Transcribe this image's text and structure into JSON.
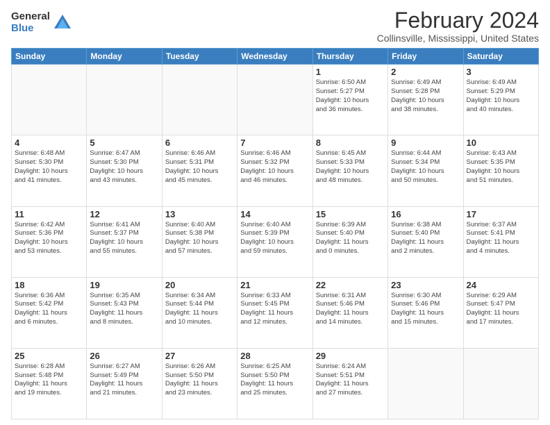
{
  "logo": {
    "general": "General",
    "blue": "Blue"
  },
  "header": {
    "title": "February 2024",
    "subtitle": "Collinsville, Mississippi, United States"
  },
  "weekdays": [
    "Sunday",
    "Monday",
    "Tuesday",
    "Wednesday",
    "Thursday",
    "Friday",
    "Saturday"
  ],
  "weeks": [
    [
      {
        "day": "",
        "info": ""
      },
      {
        "day": "",
        "info": ""
      },
      {
        "day": "",
        "info": ""
      },
      {
        "day": "",
        "info": ""
      },
      {
        "day": "1",
        "info": "Sunrise: 6:50 AM\nSunset: 5:27 PM\nDaylight: 10 hours\nand 36 minutes."
      },
      {
        "day": "2",
        "info": "Sunrise: 6:49 AM\nSunset: 5:28 PM\nDaylight: 10 hours\nand 38 minutes."
      },
      {
        "day": "3",
        "info": "Sunrise: 6:49 AM\nSunset: 5:29 PM\nDaylight: 10 hours\nand 40 minutes."
      }
    ],
    [
      {
        "day": "4",
        "info": "Sunrise: 6:48 AM\nSunset: 5:30 PM\nDaylight: 10 hours\nand 41 minutes."
      },
      {
        "day": "5",
        "info": "Sunrise: 6:47 AM\nSunset: 5:30 PM\nDaylight: 10 hours\nand 43 minutes."
      },
      {
        "day": "6",
        "info": "Sunrise: 6:46 AM\nSunset: 5:31 PM\nDaylight: 10 hours\nand 45 minutes."
      },
      {
        "day": "7",
        "info": "Sunrise: 6:46 AM\nSunset: 5:32 PM\nDaylight: 10 hours\nand 46 minutes."
      },
      {
        "day": "8",
        "info": "Sunrise: 6:45 AM\nSunset: 5:33 PM\nDaylight: 10 hours\nand 48 minutes."
      },
      {
        "day": "9",
        "info": "Sunrise: 6:44 AM\nSunset: 5:34 PM\nDaylight: 10 hours\nand 50 minutes."
      },
      {
        "day": "10",
        "info": "Sunrise: 6:43 AM\nSunset: 5:35 PM\nDaylight: 10 hours\nand 51 minutes."
      }
    ],
    [
      {
        "day": "11",
        "info": "Sunrise: 6:42 AM\nSunset: 5:36 PM\nDaylight: 10 hours\nand 53 minutes."
      },
      {
        "day": "12",
        "info": "Sunrise: 6:41 AM\nSunset: 5:37 PM\nDaylight: 10 hours\nand 55 minutes."
      },
      {
        "day": "13",
        "info": "Sunrise: 6:40 AM\nSunset: 5:38 PM\nDaylight: 10 hours\nand 57 minutes."
      },
      {
        "day": "14",
        "info": "Sunrise: 6:40 AM\nSunset: 5:39 PM\nDaylight: 10 hours\nand 59 minutes."
      },
      {
        "day": "15",
        "info": "Sunrise: 6:39 AM\nSunset: 5:40 PM\nDaylight: 11 hours\nand 0 minutes."
      },
      {
        "day": "16",
        "info": "Sunrise: 6:38 AM\nSunset: 5:40 PM\nDaylight: 11 hours\nand 2 minutes."
      },
      {
        "day": "17",
        "info": "Sunrise: 6:37 AM\nSunset: 5:41 PM\nDaylight: 11 hours\nand 4 minutes."
      }
    ],
    [
      {
        "day": "18",
        "info": "Sunrise: 6:36 AM\nSunset: 5:42 PM\nDaylight: 11 hours\nand 6 minutes."
      },
      {
        "day": "19",
        "info": "Sunrise: 6:35 AM\nSunset: 5:43 PM\nDaylight: 11 hours\nand 8 minutes."
      },
      {
        "day": "20",
        "info": "Sunrise: 6:34 AM\nSunset: 5:44 PM\nDaylight: 11 hours\nand 10 minutes."
      },
      {
        "day": "21",
        "info": "Sunrise: 6:33 AM\nSunset: 5:45 PM\nDaylight: 11 hours\nand 12 minutes."
      },
      {
        "day": "22",
        "info": "Sunrise: 6:31 AM\nSunset: 5:46 PM\nDaylight: 11 hours\nand 14 minutes."
      },
      {
        "day": "23",
        "info": "Sunrise: 6:30 AM\nSunset: 5:46 PM\nDaylight: 11 hours\nand 15 minutes."
      },
      {
        "day": "24",
        "info": "Sunrise: 6:29 AM\nSunset: 5:47 PM\nDaylight: 11 hours\nand 17 minutes."
      }
    ],
    [
      {
        "day": "25",
        "info": "Sunrise: 6:28 AM\nSunset: 5:48 PM\nDaylight: 11 hours\nand 19 minutes."
      },
      {
        "day": "26",
        "info": "Sunrise: 6:27 AM\nSunset: 5:49 PM\nDaylight: 11 hours\nand 21 minutes."
      },
      {
        "day": "27",
        "info": "Sunrise: 6:26 AM\nSunset: 5:50 PM\nDaylight: 11 hours\nand 23 minutes."
      },
      {
        "day": "28",
        "info": "Sunrise: 6:25 AM\nSunset: 5:50 PM\nDaylight: 11 hours\nand 25 minutes."
      },
      {
        "day": "29",
        "info": "Sunrise: 6:24 AM\nSunset: 5:51 PM\nDaylight: 11 hours\nand 27 minutes."
      },
      {
        "day": "",
        "info": ""
      },
      {
        "day": "",
        "info": ""
      }
    ]
  ]
}
